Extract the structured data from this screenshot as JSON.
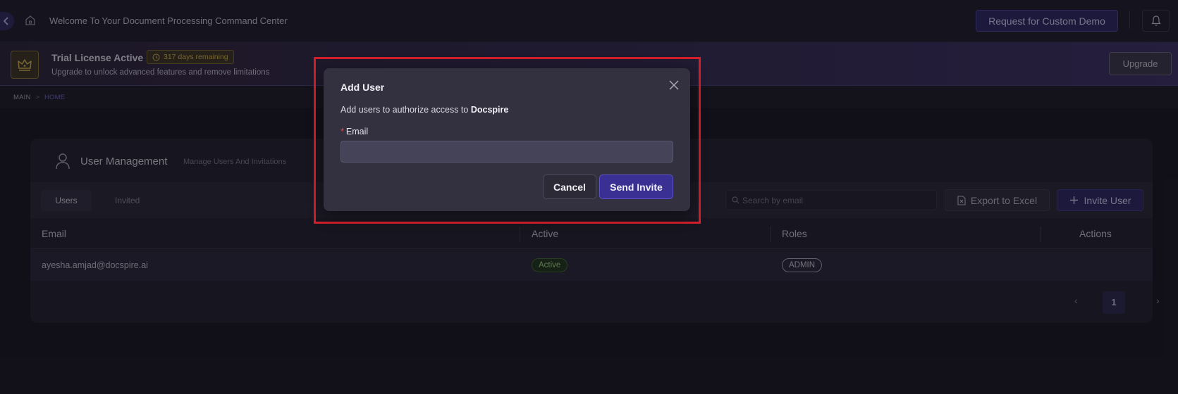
{
  "topbar": {
    "welcome_text": "Welcome To Your Document Processing Command Center",
    "demo_button": "Request for Custom Demo"
  },
  "banner": {
    "title": "Trial License Active",
    "days_badge": "317 days remaining",
    "subtitle": "Upgrade to unlock advanced features and remove limitations",
    "upgrade_button": "Upgrade"
  },
  "breadcrumb": {
    "items": [
      "MAIN",
      "HOME"
    ],
    "separator": ">"
  },
  "card": {
    "title": "User Management",
    "subtitle": "Manage Users And Invitations",
    "tabs": [
      {
        "label": "Users",
        "selected": true
      },
      {
        "label": "Invited",
        "selected": false
      }
    ],
    "search_placeholder": "Search by email",
    "export_button": "Export to Excel",
    "invite_button": "Invite User",
    "table": {
      "columns": [
        "Email",
        "Active",
        "Roles",
        "Actions"
      ],
      "rows": [
        {
          "email": "ayesha.amjad@docspire.ai",
          "active": "Active",
          "role": "ADMIN"
        }
      ]
    },
    "pagination": {
      "current_page": "1",
      "prev": "‹",
      "next": "›"
    }
  },
  "modal": {
    "title": "Add User",
    "description_prefix": "Add users to authorize access to",
    "description_brand": "Docspire",
    "email_label": "Email",
    "required_mark": "*",
    "email_value": "",
    "email_placeholder": "",
    "cancel_button": "Cancel",
    "send_button": "Send Invite"
  },
  "colors": {
    "accent": "#3a2f92",
    "highlight_border": "#d41f29",
    "trial_badge": "#d9b94a",
    "active_badge": "#a8d98a",
    "required": "#e0474f"
  },
  "icons": {
    "back": "chevron-left-icon",
    "home": "home-icon",
    "bell": "bell-icon",
    "crown": "crown-icon",
    "clock": "clock-icon",
    "user": "user-icon",
    "search": "search-icon",
    "export": "file-excel-icon",
    "plus": "plus-icon",
    "close": "close-icon"
  }
}
